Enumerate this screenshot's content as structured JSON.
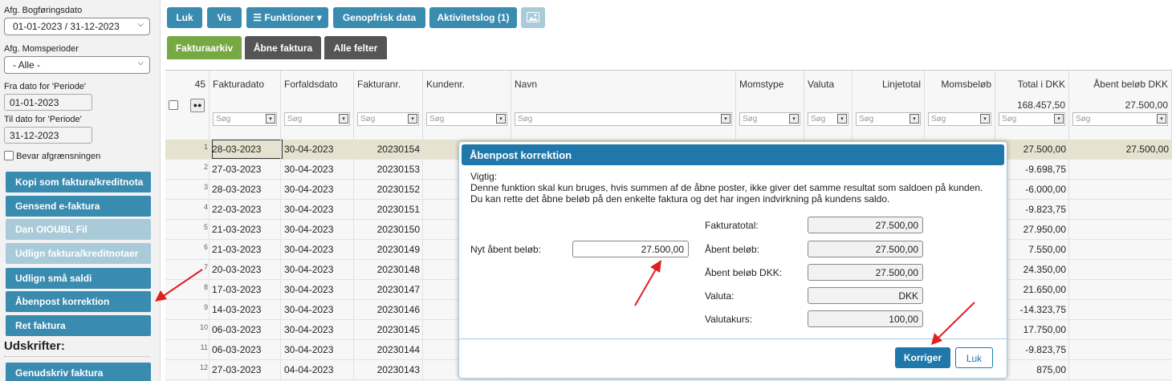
{
  "sidebar": {
    "bogforing_label": "Afg. Bogføringsdato",
    "bogforing_value": "01-01-2023 / 31-12-2023",
    "moms_label": "Afg. Momsperioder",
    "moms_value": "- Alle -",
    "fra_label": "Fra dato for 'Periode'",
    "fra_value": "01-01-2023",
    "til_label": "Til dato for 'Periode'",
    "til_value": "31-12-2023",
    "bevar_label": "Bevar afgrænsningen",
    "buttons": [
      {
        "label": "Kopi som faktura/kreditnota"
      },
      {
        "label": "Gensend e-faktura"
      },
      {
        "label": "Dan OIOUBL Fil"
      },
      {
        "label": "Udlign faktura/kreditnotaer"
      },
      {
        "label": "Udlign små saldi"
      },
      {
        "label": "Åbenpost korrektion"
      },
      {
        "label": "Ret faktura"
      }
    ],
    "section_title": "Udskrifter:",
    "print_button": "Genudskriv faktura"
  },
  "toolbar": {
    "luk": "Luk",
    "vis": "Vis",
    "funktioner": "Funktioner",
    "genopfrisk": "Genopfrisk data",
    "aktivitetslog": "Aktivitetslog (1)",
    "image_icon": "image-icon"
  },
  "tabs": [
    "Fakturaarkiv",
    "Åbne faktura",
    "Alle felter"
  ],
  "grid": {
    "count": "45",
    "search_placeholder": "Søg",
    "columns": [
      "Fakturadato",
      "Forfaldsdato",
      "Fakturanr.",
      "Kundenr.",
      "Navn",
      "Momstype",
      "Valuta",
      "Linjetotal",
      "Momsbeløb",
      "Total i DKK",
      "Åbent beløb DKK"
    ],
    "total_dkk": "168.457,50",
    "aabent_total": "27.500,00",
    "rows": [
      {
        "n": "1",
        "dato": "28-03-2023",
        "forfald": "30-04-2023",
        "nr": "20230154",
        "total": "27.500,00",
        "aabent": "27.500,00"
      },
      {
        "n": "2",
        "dato": "27-03-2023",
        "forfald": "30-04-2023",
        "nr": "20230153",
        "total": "-9.698,75",
        "aabent": ""
      },
      {
        "n": "3",
        "dato": "28-03-2023",
        "forfald": "30-04-2023",
        "nr": "20230152",
        "total": "-6.000,00",
        "aabent": ""
      },
      {
        "n": "4",
        "dato": "22-03-2023",
        "forfald": "30-04-2023",
        "nr": "20230151",
        "total": "-9.823,75",
        "aabent": ""
      },
      {
        "n": "5",
        "dato": "21-03-2023",
        "forfald": "30-04-2023",
        "nr": "20230150",
        "total": "27.950,00",
        "aabent": ""
      },
      {
        "n": "6",
        "dato": "21-03-2023",
        "forfald": "30-04-2023",
        "nr": "20230149",
        "total": "7.550,00",
        "aabent": ""
      },
      {
        "n": "7",
        "dato": "20-03-2023",
        "forfald": "30-04-2023",
        "nr": "20230148",
        "total": "24.350,00",
        "aabent": ""
      },
      {
        "n": "8",
        "dato": "17-03-2023",
        "forfald": "30-04-2023",
        "nr": "20230147",
        "total": "21.650,00",
        "aabent": ""
      },
      {
        "n": "9",
        "dato": "14-03-2023",
        "forfald": "30-04-2023",
        "nr": "20230146",
        "total": "-14.323,75",
        "aabent": ""
      },
      {
        "n": "10",
        "dato": "06-03-2023",
        "forfald": "30-04-2023",
        "nr": "20230145",
        "total": "17.750,00",
        "aabent": ""
      },
      {
        "n": "11",
        "dato": "06-03-2023",
        "forfald": "30-04-2023",
        "nr": "20230144",
        "total": "-9.823,75",
        "aabent": ""
      },
      {
        "n": "12",
        "dato": "27-03-2023",
        "forfald": "04-04-2023",
        "nr": "20230143",
        "total": "875,00",
        "aabent": ""
      }
    ]
  },
  "dialog": {
    "title": "Åbenpost korrektion",
    "vigtig": "Vigtig:",
    "line1": "Denne funktion skal kun bruges, hvis summen af de åbne poster, ikke giver det samme resultat som saldoen på kunden.",
    "line2": "Du kan rette det åbne beløb på den enkelte faktura og det har ingen indvirkning på kundens saldo.",
    "nyt_label": "Nyt åbent beløb:",
    "nyt_value": "27.500,00",
    "fakturatotal_label": "Fakturatotal:",
    "fakturatotal_value": "27.500,00",
    "aabent_label": "Åbent beløb:",
    "aabent_value": "27.500,00",
    "aabent_dkk_label": "Åbent beløb DKK:",
    "aabent_dkk_value": "27.500,00",
    "valuta_label": "Valuta:",
    "valuta_value": "DKK",
    "kurs_label": "Valutakurs:",
    "kurs_value": "100,00",
    "korriger": "Korriger",
    "luk": "Luk"
  },
  "colors": {
    "accent": "#3a8bb0",
    "tab_active": "#76a944",
    "dialog_header": "#1f78a9",
    "arrow": "#e02020"
  }
}
